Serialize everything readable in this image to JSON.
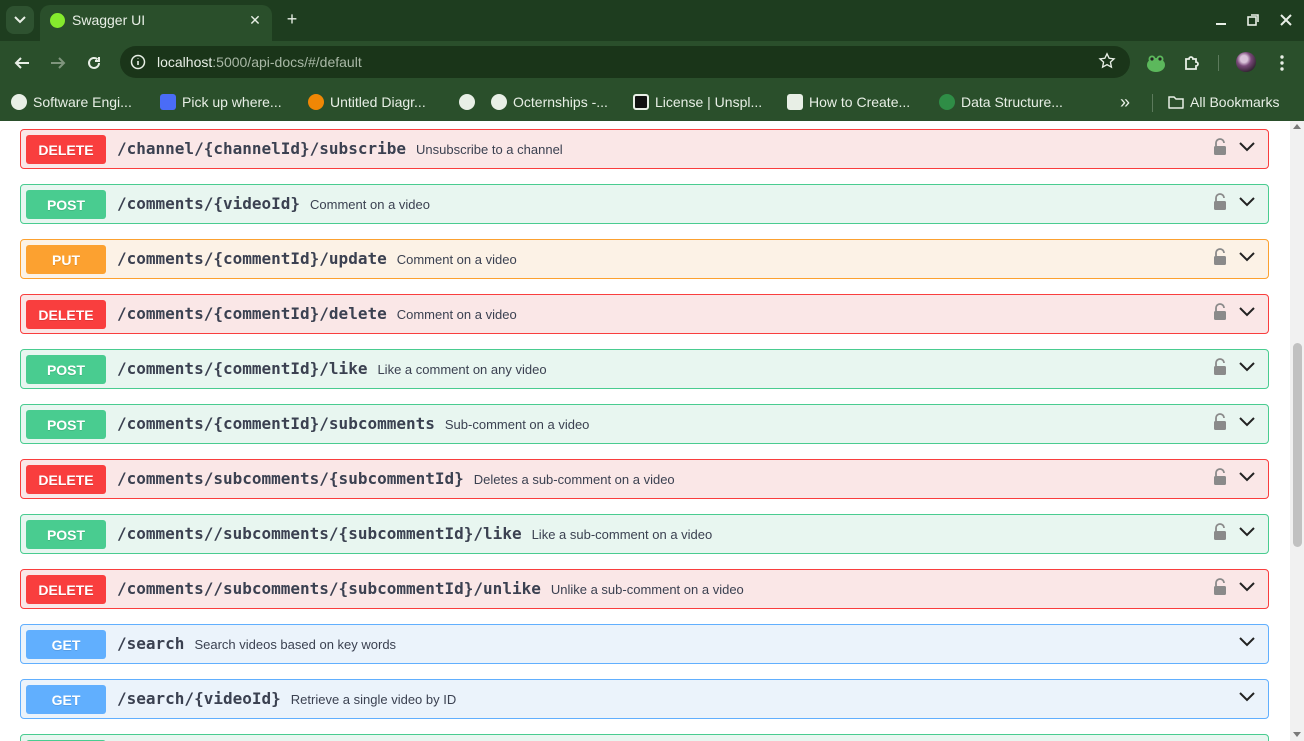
{
  "browser": {
    "tab_title": "Swagger UI",
    "url_host": "localhost",
    "url_rest": ":5000/api-docs/#/default",
    "bookmarks": [
      "Software Engi...",
      "Pick up where...",
      "Untitled Diagr...",
      "",
      "Octernships -...",
      "License | Unspl...",
      "How to Create...",
      "Data Structure..."
    ],
    "all_bookmarks": "All Bookmarks",
    "overflow": "»"
  },
  "operations": [
    {
      "method": "DELETE",
      "path": "/channel/{channelId}/subscribe",
      "summary": "Unsubscribe to a channel"
    },
    {
      "method": "POST",
      "path": "/comments/{videoId}",
      "summary": "Comment on a video"
    },
    {
      "method": "PUT",
      "path": "/comments/{commentId}/update",
      "summary": "Comment on a video"
    },
    {
      "method": "DELETE",
      "path": "/comments/{commentId}/delete",
      "summary": "Comment on a video"
    },
    {
      "method": "POST",
      "path": "/comments/{commentId}/like",
      "summary": "Like a comment on any video"
    },
    {
      "method": "POST",
      "path": "/comments/{commentId}/subcomments",
      "summary": "Sub-comment on a video"
    },
    {
      "method": "DELETE",
      "path": "/comments/subcomments/{subcommentId}",
      "summary": "Deletes a sub-comment on a video"
    },
    {
      "method": "POST",
      "path": "/comments//subcomments/{subcommentId}/like",
      "summary": "Like a sub-comment on a video"
    },
    {
      "method": "DELETE",
      "path": "/comments//subcomments/{subcommentId}/unlike",
      "summary": "Unlike a sub-comment on a video"
    },
    {
      "method": "GET",
      "path": "/search",
      "summary": "Search videos based on key words"
    },
    {
      "method": "GET",
      "path": "/search/{videoId}",
      "summary": "Retrieve a single video by ID"
    }
  ],
  "colors": {
    "delete": "#f93e3e",
    "post": "#49cc90",
    "put": "#fca130",
    "get": "#61affe",
    "chrome": "#2a4f2b"
  }
}
